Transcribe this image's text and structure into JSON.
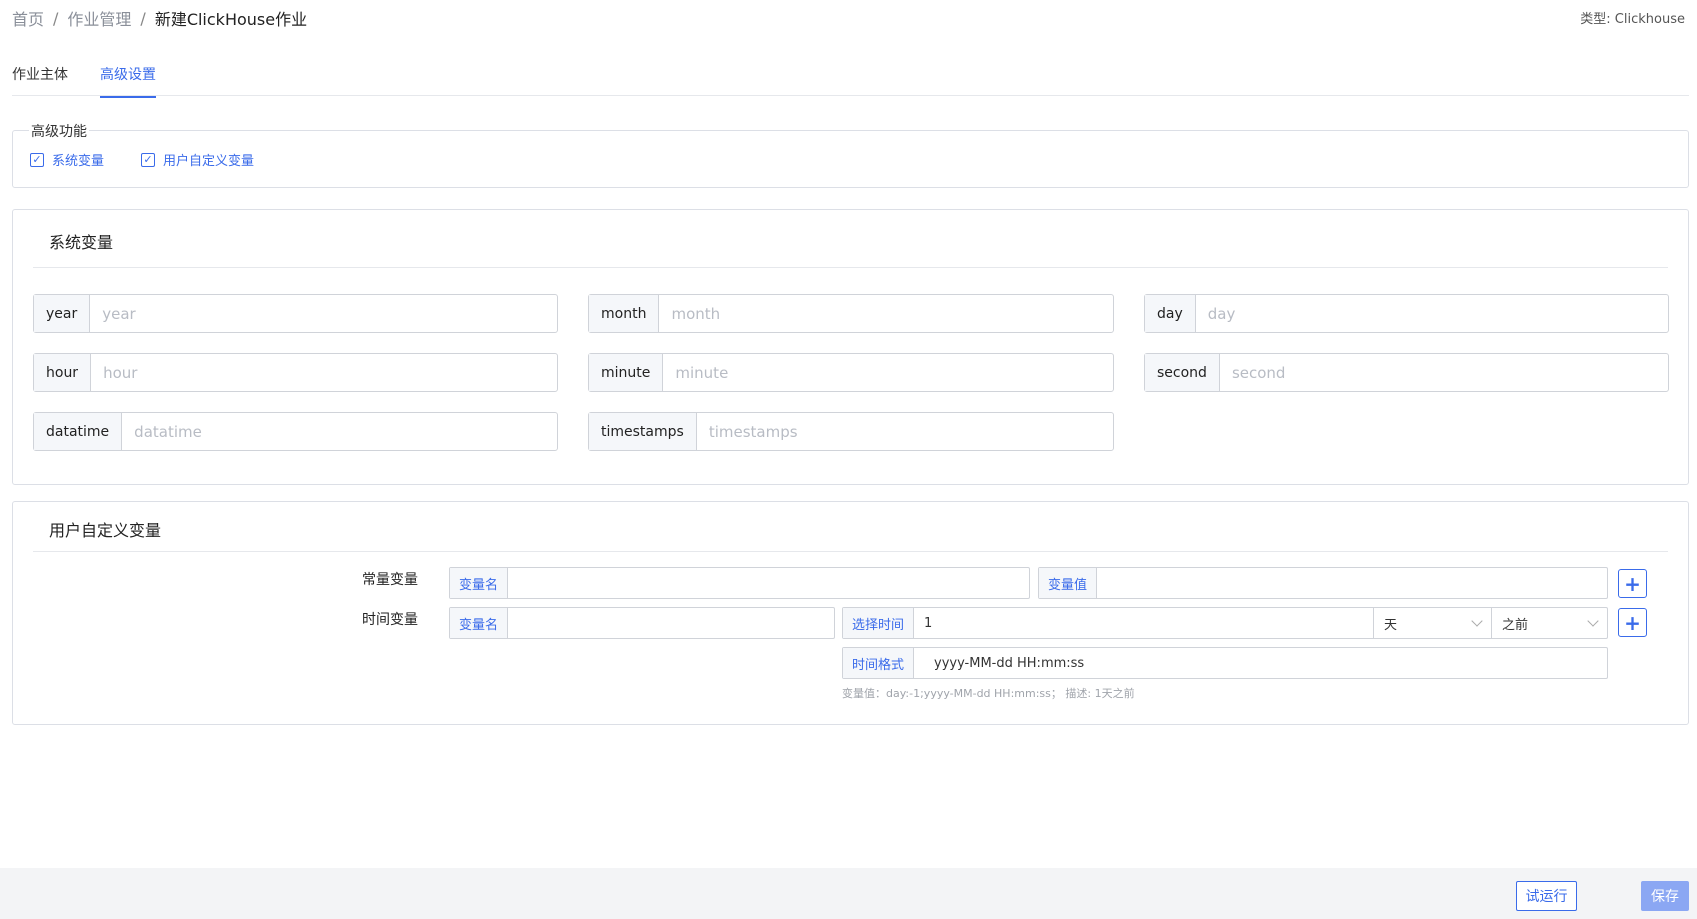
{
  "breadcrumb": [
    "首页",
    "作业管理",
    "新建ClickHouse作业"
  ],
  "breadcrumb_sep": "/",
  "type_label": "类型: Clickhouse",
  "tabs": [
    {
      "label": "作业主体",
      "active": false
    },
    {
      "label": "高级设置",
      "active": true
    }
  ],
  "advanced": {
    "legend": "高级功能",
    "checkboxes": [
      {
        "label": "系统变量",
        "checked": true
      },
      {
        "label": "用户自定义变量",
        "checked": true
      }
    ]
  },
  "system_vars": {
    "title": "系统变量",
    "fields": [
      {
        "label": "year",
        "placeholder": "year",
        "value": ""
      },
      {
        "label": "month",
        "placeholder": "month",
        "value": ""
      },
      {
        "label": "day",
        "placeholder": "day",
        "value": ""
      },
      {
        "label": "hour",
        "placeholder": "hour",
        "value": ""
      },
      {
        "label": "minute",
        "placeholder": "minute",
        "value": ""
      },
      {
        "label": "second",
        "placeholder": "second",
        "value": ""
      },
      {
        "label": "datatime",
        "placeholder": "datatime",
        "value": ""
      },
      {
        "label": "timestamps",
        "placeholder": "timestamps",
        "value": ""
      }
    ]
  },
  "user_vars": {
    "title": "用户自定义变量",
    "constant": {
      "row_label": "常量变量",
      "name_addon": "变量名",
      "name_value": "",
      "value_addon": "变量值",
      "value_value": ""
    },
    "time": {
      "row_label": "时间变量",
      "name_addon": "变量名",
      "name_value": "",
      "select_addon": "选择时间",
      "select_value": "1",
      "unit": "天",
      "direction": "之前",
      "format_addon": "时间格式",
      "format_value": "yyyy-MM-dd HH:mm:ss",
      "hint": "变量值：day:-1;yyyy-MM-dd HH:mm:ss；  描述: 1天之前"
    },
    "plus": "+"
  },
  "footer": {
    "trial_label": "试运行",
    "save_label": "保存"
  },
  "colors": {
    "accent": "#3a6bea",
    "save_bg": "#8ba7f3",
    "footer_bg": "#f3f4f6"
  },
  "icons": [
    "checkbox-checked-icon",
    "chevron-down-icon",
    "plus-icon"
  ]
}
